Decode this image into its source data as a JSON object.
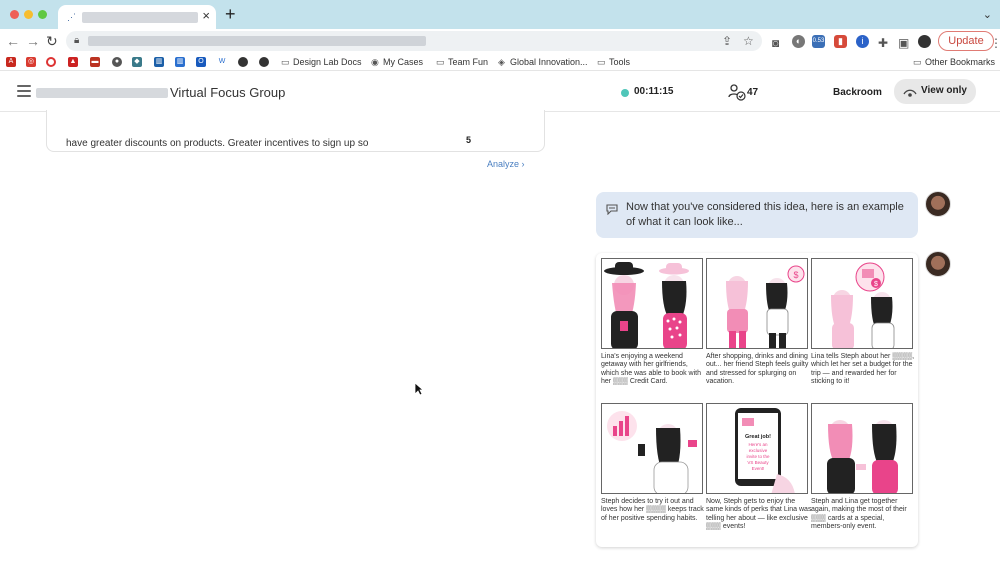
{
  "browser": {
    "tab_favicon": "share-icon",
    "new_tab": "+",
    "close_tab": "×",
    "update_label": "Update",
    "extension_badge": "0.53",
    "bookmarks": [
      {
        "label": "Design Lab Docs",
        "icon": "folder-icon"
      },
      {
        "label": "My Cases",
        "icon": "globe-icon"
      },
      {
        "label": "Team Fun",
        "icon": "folder-icon"
      },
      {
        "label": "Global Innovation...",
        "icon": "bookmark-icon"
      },
      {
        "label": "Tools",
        "icon": "folder-icon"
      }
    ],
    "other_bookmarks": "Other Bookmarks"
  },
  "header": {
    "title": "Virtual Focus Group",
    "timer": "00:11:15",
    "timer_color": "#4fc6b9",
    "participants": "47",
    "backroom_label": "Backroom",
    "view_only_label": "View only"
  },
  "response": {
    "text": "have greater discounts on products. Greater incentives to sign up so",
    "count": "5",
    "analyze_label": "Analyze ›"
  },
  "chat": {
    "message": "Now that you've considered this idea, here is an example of what it can look like...",
    "storyboard": {
      "panels": [
        {
          "caption": "Lina's enjoying a weekend getaway with her girlfriends, which she was able to book with her ▒▒▒ Credit Card."
        },
        {
          "caption": "After shopping, drinks and dining out... her friend Steph feels guilty and stressed for splurging on vacation."
        },
        {
          "caption": "Lina tells Steph about her ▒▒▒▒, which let her set a budget for the trip — and rewarded her for sticking to it!"
        },
        {
          "caption": "Steph decides to try it out and loves how her ▒▒▒▒ keeps track of her positive spending habits."
        },
        {
          "caption": "Now, Steph gets to enjoy the same kinds of perks that Lina was telling her about — like exclusive ▒▒▒ events!"
        },
        {
          "caption": "Steph and Lina get together again, making the most of their ▒▒▒ cards at a special, members-only event."
        }
      ],
      "phone_text": {
        "line1": "Great job!",
        "line2": "Here's an exclusive invite to the VS Beauty Event!"
      }
    }
  },
  "colors": {
    "accent_pink": "#e9448a",
    "light_pink": "#f6c1d8",
    "bubble": "#dfe8f4",
    "link": "#4a7fc1"
  }
}
